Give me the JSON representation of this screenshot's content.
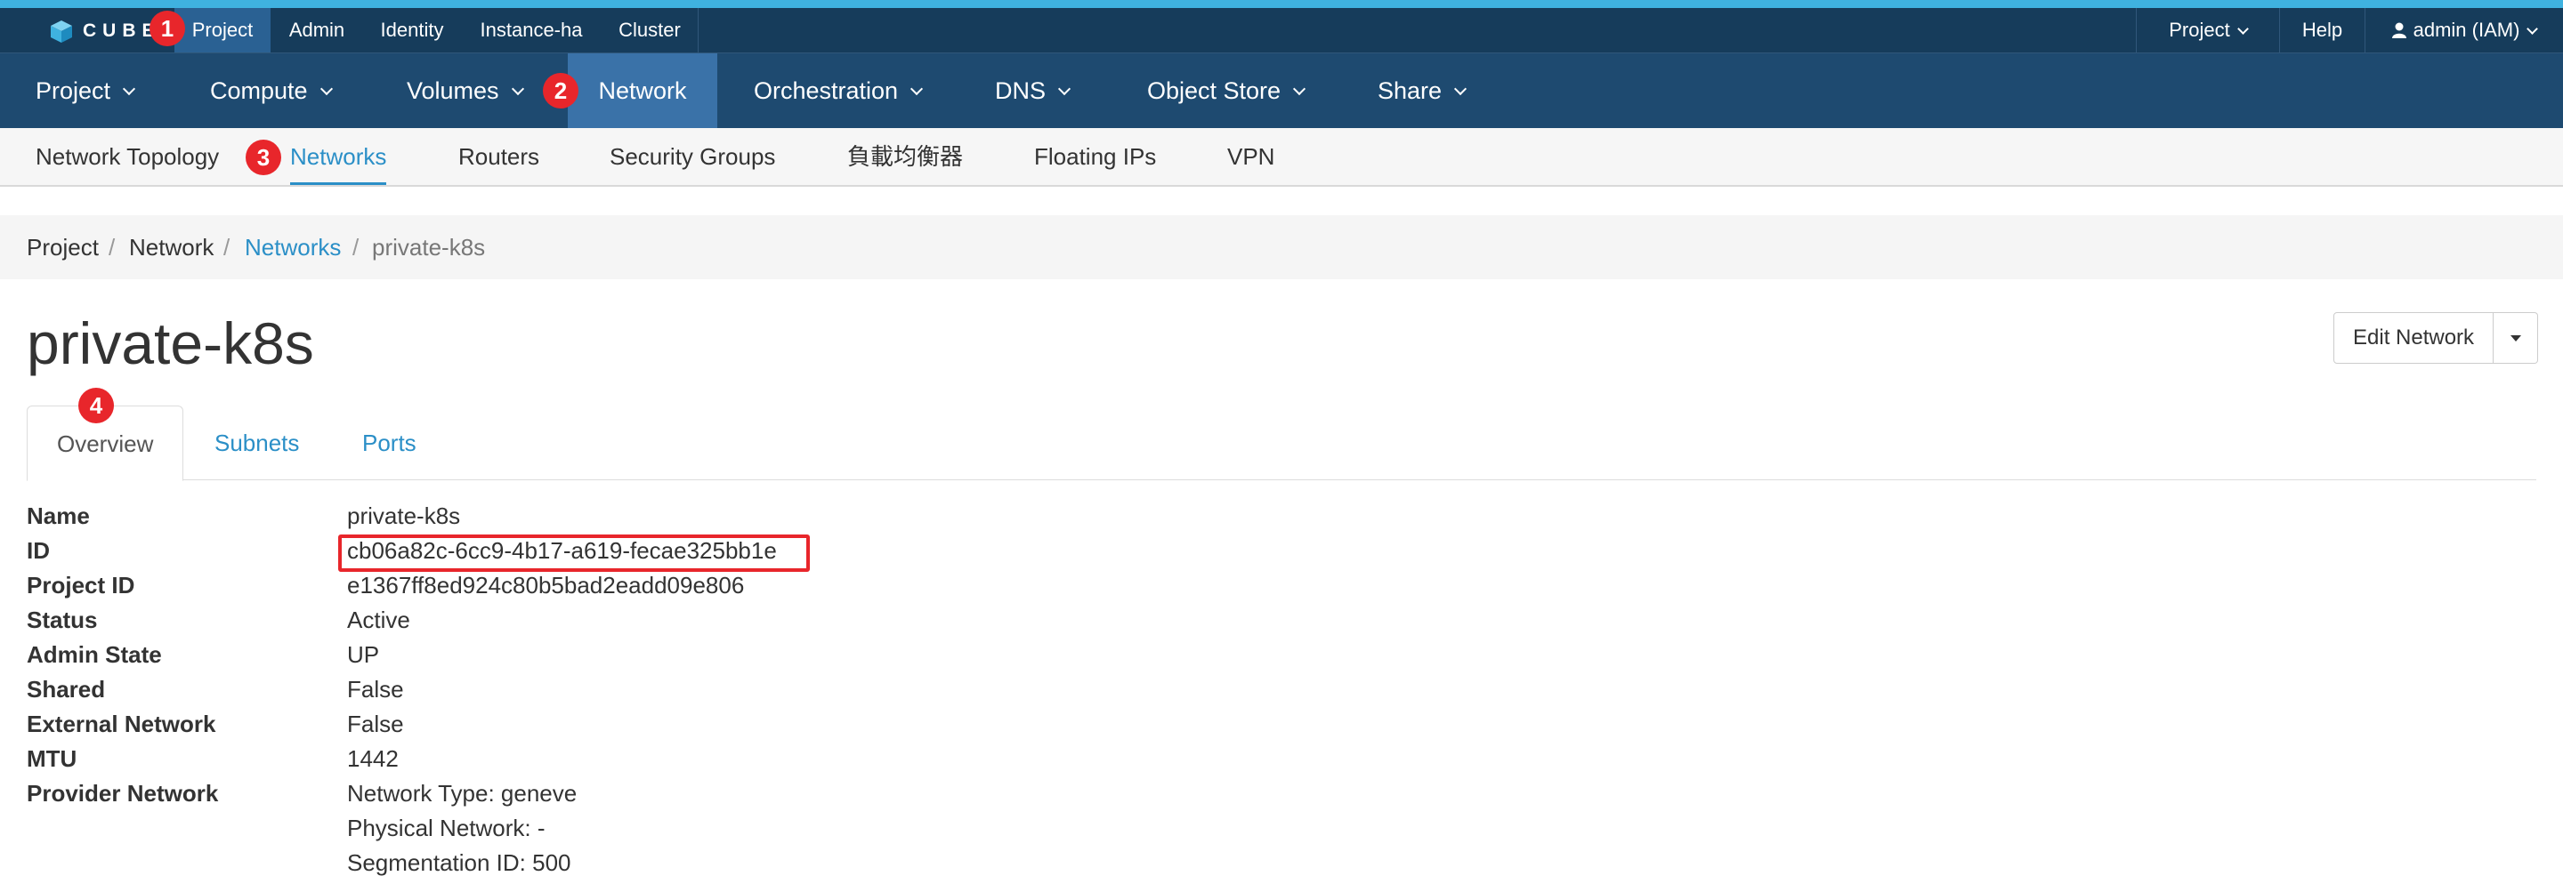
{
  "brand": {
    "logo_text": "CUBE"
  },
  "colors": {
    "accent": "#3fb2e0",
    "topbar": "#163c5b",
    "mainnav": "#1e4a70",
    "nav_active": "#3a72a8",
    "link": "#2b8fc7",
    "annotation": "#e8262b"
  },
  "top_menu": {
    "left": [
      "Project",
      "Admin",
      "Identity",
      "Instance-ha",
      "Cluster"
    ],
    "right": {
      "project": "Project",
      "help": "Help",
      "user": "admin (IAM)"
    }
  },
  "main_nav": [
    "Project",
    "Compute",
    "Volumes",
    "Network",
    "Orchestration",
    "DNS",
    "Object Store",
    "Share"
  ],
  "sub_nav": [
    "Network Topology",
    "Networks",
    "Routers",
    "Security Groups",
    "負載均衡器",
    "Floating IPs",
    "VPN"
  ],
  "breadcrumb": [
    "Project",
    "Network",
    "Networks",
    "private-k8s"
  ],
  "page": {
    "title": "private-k8s",
    "edit_button": "Edit Network",
    "tabs": [
      "Overview",
      "Subnets",
      "Ports"
    ]
  },
  "details": [
    {
      "key": "Name",
      "value": "private-k8s"
    },
    {
      "key": "ID",
      "value": "cb06a82c-6cc9-4b17-a619-fecae325bb1e"
    },
    {
      "key": "Project ID",
      "value": "e1367ff8ed924c80b5bad2eadd09e806"
    },
    {
      "key": "Status",
      "value": "Active"
    },
    {
      "key": "Admin State",
      "value": "UP"
    },
    {
      "key": "Shared",
      "value": "False"
    },
    {
      "key": "External Network",
      "value": "False"
    },
    {
      "key": "MTU",
      "value": "1442"
    },
    {
      "key": "Provider Network",
      "value": "Network Type: geneve"
    },
    {
      "key": "",
      "value": "Physical Network: -"
    },
    {
      "key": "",
      "value": "Segmentation ID: 500"
    }
  ],
  "annotations": [
    "1",
    "2",
    "3",
    "4"
  ]
}
